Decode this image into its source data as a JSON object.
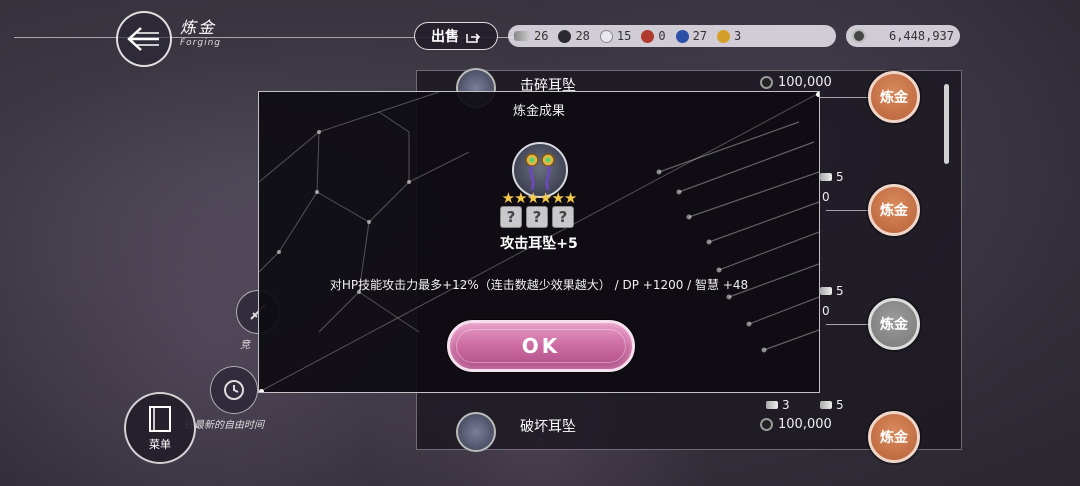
{
  "header": {
    "title": "炼金",
    "subtitle": "Forging",
    "sell_label": "出售"
  },
  "currencies": [
    {
      "icon": "dust-icon",
      "value": "26",
      "color": "#9a9aa0"
    },
    {
      "icon": "black-orb-icon",
      "value": "28",
      "color": "#2a2a30"
    },
    {
      "icon": "white-orb-icon",
      "value": "15",
      "color": "#e8e8ee"
    },
    {
      "icon": "red-orb-icon",
      "value": "0",
      "color": "#b03a2e"
    },
    {
      "icon": "blue-orb-icon",
      "value": "27",
      "color": "#2c4fa8"
    },
    {
      "icon": "gold-orb-icon",
      "value": "3",
      "color": "#d4a02a"
    }
  ],
  "money": {
    "value": "6,448,937"
  },
  "list": {
    "items": [
      {
        "name": "击碎耳坠",
        "price": "100,000",
        "forge_label": "炼金"
      },
      {
        "stat": "5",
        "stat2": "0",
        "forge_label": "炼金"
      },
      {
        "stat": "5",
        "stat2": "0",
        "forge_label": "炼金"
      },
      {
        "name": "破坏耳坠",
        "price": "100,000",
        "stat_a": "3",
        "stat_b": "5",
        "forge_label": "炼金"
      }
    ]
  },
  "side": {
    "free_time_label": "往最新的自由时间",
    "menu_label": "菜单",
    "partial_label": "竞"
  },
  "modal": {
    "title": "炼金成果",
    "stars": "★★★★★★",
    "slot_glyph": "?",
    "item_name": "攻击耳坠+5",
    "effect": "对HP技能攻击力最多+12%（连击数越少效果越大） / DP +1200 / 智慧 +48",
    "ok_label": "OK"
  },
  "colors": {
    "accent_pink": "#c9679f",
    "forge_orange": "#c8704a",
    "star_gold": "#f2c94c"
  }
}
